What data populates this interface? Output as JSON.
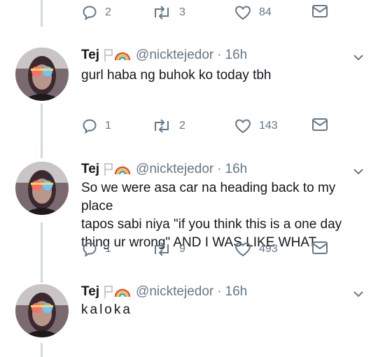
{
  "top_actions": {
    "reply_count": "2",
    "retweet_count": "3",
    "like_count": "84"
  },
  "tweets": [
    {
      "name": "Tej",
      "handle": "@nicktejedor",
      "separator": "·",
      "time": "16h",
      "text": "gurl haba ng buhok ko today tbh",
      "reply_count": "1",
      "retweet_count": "2",
      "like_count": "143"
    },
    {
      "name": "Tej",
      "handle": "@nicktejedor",
      "separator": "·",
      "time": "16h",
      "text_lines": [
        "So we were asa car na heading back to my place",
        "tapos sabi niya \"if you think this is a one day",
        "thing ur wrong\" AND I WAS LIKE WHAT"
      ],
      "reply_count": "1",
      "retweet_count": "9",
      "like_count": "493"
    },
    {
      "name": "Tej",
      "handle": "@nicktejedor",
      "separator": "·",
      "time": "16h",
      "text": "kaloka"
    }
  ],
  "icons": {
    "reply": "reply-icon",
    "retweet": "retweet-icon",
    "like": "heart-icon",
    "dm": "envelope-icon",
    "flag": "flag-icon",
    "rainbow": "rainbow-icon",
    "more": "chevron-down-icon"
  },
  "colors": {
    "icon_gray": "#657786",
    "line": "#cfd9de",
    "text": "#14171a"
  }
}
